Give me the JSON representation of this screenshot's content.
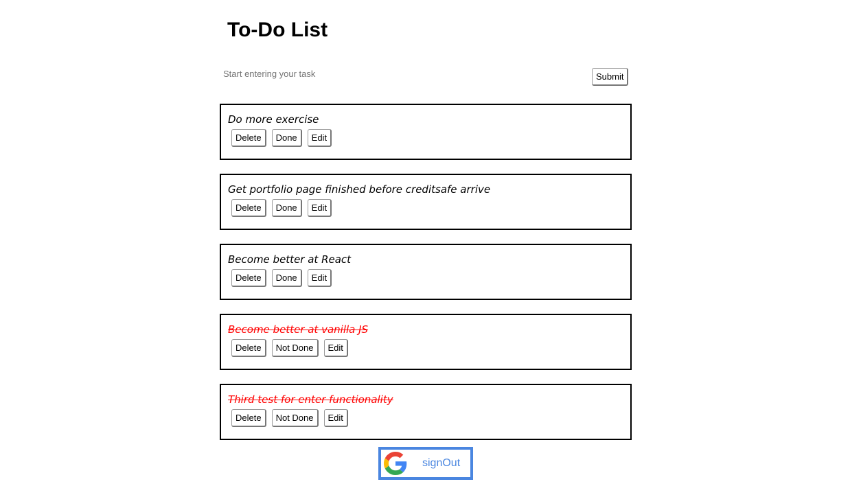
{
  "header": {
    "title": "To-Do List"
  },
  "new_task": {
    "placeholder": "Start entering your task",
    "value": "",
    "submit_label": "Submit"
  },
  "todos": [
    {
      "text": "Do more exercise",
      "done": false,
      "delete_label": "Delete",
      "toggle_label": "Done",
      "edit_label": "Edit"
    },
    {
      "text": "Get portfolio page finished before creditsafe arrive",
      "done": false,
      "delete_label": "Delete",
      "toggle_label": "Done",
      "edit_label": "Edit"
    },
    {
      "text": "Become better at React",
      "done": false,
      "delete_label": "Delete",
      "toggle_label": "Done",
      "edit_label": "Edit"
    },
    {
      "text": "Become better at vanilla JS",
      "done": true,
      "delete_label": "Delete",
      "toggle_label": "Not Done",
      "edit_label": "Edit"
    },
    {
      "text": "Third test for enter functionality",
      "done": true,
      "delete_label": "Delete",
      "toggle_label": "Not Done",
      "edit_label": "Edit"
    }
  ],
  "auth": {
    "signout_label": "signOut",
    "icon": "google-icon"
  },
  "colors": {
    "done_text": "#ff0000",
    "google_blue": "#4a86e0"
  }
}
